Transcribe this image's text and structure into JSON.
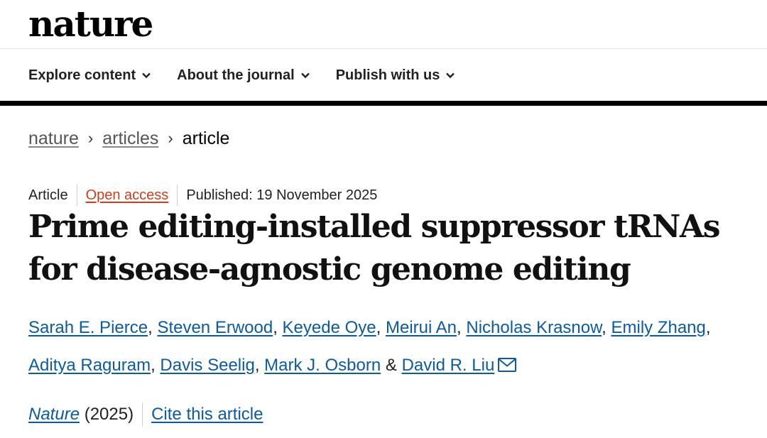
{
  "header": {
    "logo": "nature"
  },
  "nav": [
    {
      "label": "Explore content"
    },
    {
      "label": "About the journal"
    },
    {
      "label": "Publish with us"
    }
  ],
  "breadcrumb": {
    "items": [
      "nature",
      "articles"
    ],
    "current": "article",
    "separator": "›"
  },
  "article": {
    "type": "Article",
    "access": "Open access",
    "published": "Published: 19 November 2025",
    "title_line1": "Prime editing-installed suppressor tRNAs",
    "title_line2": "for disease-agnostic genome editing",
    "authors": [
      "Sarah E. Pierce",
      "Steven Erwood",
      "Keyede Oye",
      "Meirui An",
      "Nicholas Krasnow",
      "Emily Zhang",
      "Aditya Raguram",
      "Davis Seelig",
      "Mark J. Osborn",
      "David R. Liu"
    ],
    "author_sep": ", ",
    "author_last_sep": " & ",
    "journal": "Nature",
    "year": "(2025)",
    "cite_label": "Cite this article"
  },
  "colors": {
    "link": "#0c5b9e",
    "open_access": "#c7411c",
    "bar": "#000000"
  },
  "icons": [
    "chevron-down-icon",
    "mail-icon"
  ]
}
